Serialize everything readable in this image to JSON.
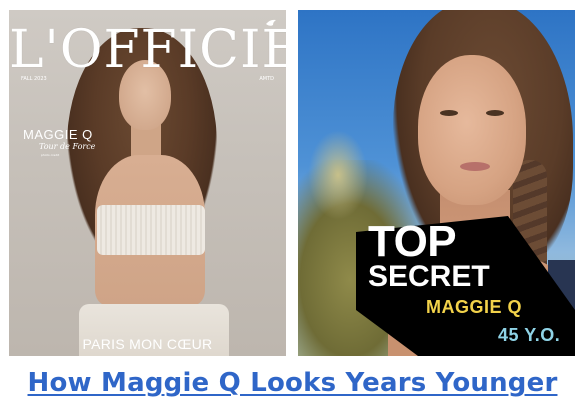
{
  "cover": {
    "masthead": "L'OFFICIEL",
    "issue_left": "FALL 2023",
    "issue_right": "AMTD",
    "cover_name": "MAGGIE Q",
    "cover_subtitle": "Tour de Force",
    "cover_credit": "photo credit",
    "bottom_line": "PARIS MON CŒUR",
    "logo_icon": "bird-icon"
  },
  "promo": {
    "line1": "TOP",
    "line2": "SECRET",
    "name": "MAGGIE Q",
    "age": "45 Y.O.",
    "banner_color": "#000000",
    "name_color": "#f2d24a",
    "age_color": "#8fd3e6"
  },
  "headline": {
    "text": "How Maggie Q Looks Years Younger",
    "color": "#2f66c8"
  }
}
